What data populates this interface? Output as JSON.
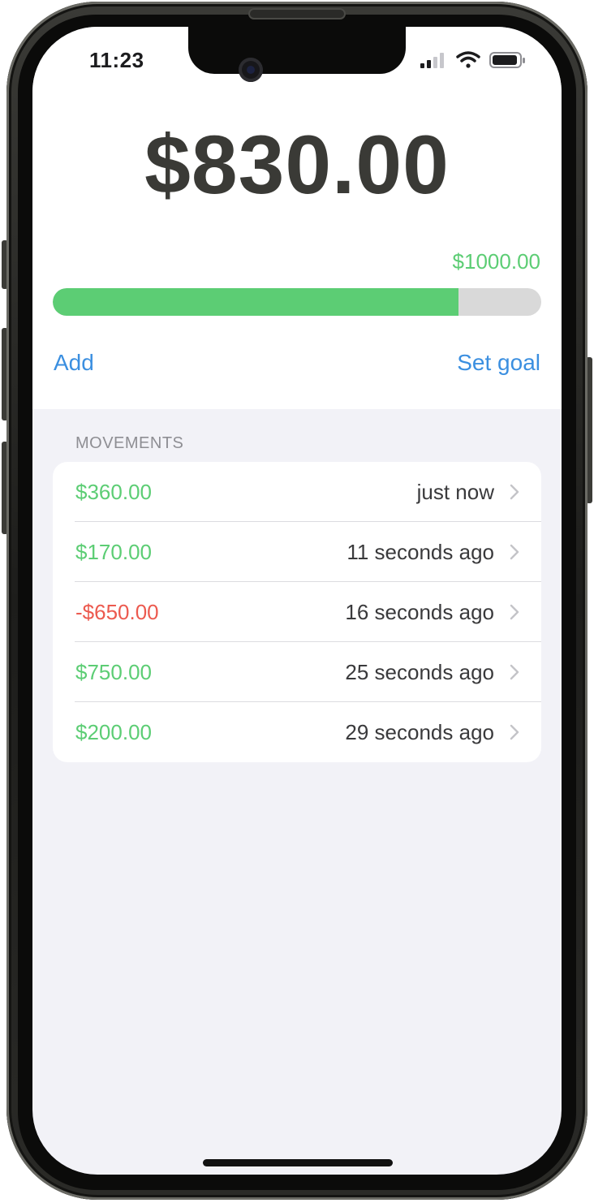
{
  "status_bar": {
    "time": "11:23",
    "icons": [
      "cellular-signal-icon",
      "wifi-icon",
      "battery-icon"
    ]
  },
  "balance": "$830.00",
  "goal": {
    "label": "$1000.00",
    "progress_fraction": 0.83
  },
  "actions": {
    "add_label": "Add",
    "set_goal_label": "Set goal"
  },
  "movements": {
    "header": "MOVEMENTS",
    "items": [
      {
        "amount": "$360.00",
        "time": "just now",
        "type": "income"
      },
      {
        "amount": "$170.00",
        "time": "11 seconds ago",
        "type": "income"
      },
      {
        "amount": "-$650.00",
        "time": "16 seconds ago",
        "type": "expense"
      },
      {
        "amount": "$750.00",
        "time": "25 seconds ago",
        "type": "income"
      },
      {
        "amount": "$200.00",
        "time": "29 seconds ago",
        "type": "income"
      }
    ]
  },
  "colors": {
    "income": "#5ccd74",
    "expense": "#ec5a4f",
    "accent": "#3b8fe0",
    "progress_track": "#d9d9d9"
  }
}
